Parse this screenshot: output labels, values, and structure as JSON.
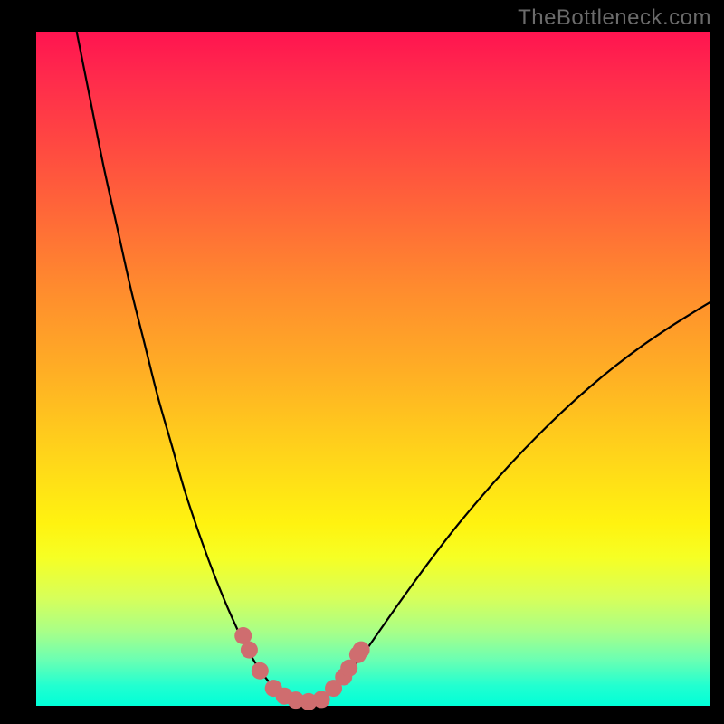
{
  "watermark": "TheBottleneck.com",
  "chart_data": {
    "type": "line",
    "title": "",
    "xlabel": "",
    "ylabel": "",
    "xlim": [
      0,
      100
    ],
    "ylim": [
      0,
      100
    ],
    "series": [
      {
        "name": "left-curve",
        "x": [
          6,
          8,
          10,
          12,
          14,
          16,
          18,
          20,
          22,
          24,
          26,
          28,
          30,
          31,
          32,
          33,
          34,
          35,
          36
        ],
        "values": [
          100,
          90,
          80,
          71,
          62,
          54,
          46,
          39,
          32,
          26,
          20.5,
          15.5,
          11,
          9,
          7.2,
          5.6,
          4.2,
          3.0,
          2.0
        ]
      },
      {
        "name": "right-curve",
        "x": [
          44,
          46,
          48,
          50,
          54,
          58,
          62,
          66,
          70,
          74,
          78,
          82,
          86,
          90,
          94,
          98,
          100
        ],
        "values": [
          2.5,
          4.5,
          7.0,
          9.8,
          15.5,
          21.0,
          26.2,
          31.0,
          35.5,
          39.7,
          43.6,
          47.2,
          50.5,
          53.5,
          56.2,
          58.7,
          59.9
        ]
      },
      {
        "name": "valley-floor",
        "x": [
          36,
          37,
          38,
          39,
          40,
          41,
          42,
          43,
          44
        ],
        "values": [
          2.0,
          1.2,
          0.8,
          0.6,
          0.55,
          0.6,
          0.8,
          1.4,
          2.5
        ]
      }
    ],
    "markers": [
      {
        "x": 30.7,
        "y": 10.4
      },
      {
        "x": 31.6,
        "y": 8.3
      },
      {
        "x": 33.2,
        "y": 5.2
      },
      {
        "x": 35.2,
        "y": 2.6
      },
      {
        "x": 36.8,
        "y": 1.45
      },
      {
        "x": 38.5,
        "y": 0.85
      },
      {
        "x": 40.4,
        "y": 0.62
      },
      {
        "x": 42.3,
        "y": 0.95
      },
      {
        "x": 44.1,
        "y": 2.6
      },
      {
        "x": 45.6,
        "y": 4.3
      },
      {
        "x": 46.4,
        "y": 5.6
      },
      {
        "x": 47.7,
        "y": 7.6
      },
      {
        "x": 48.2,
        "y": 8.3
      }
    ],
    "colors": {
      "curve": "#000000",
      "marker": "#cf6d6f"
    }
  }
}
